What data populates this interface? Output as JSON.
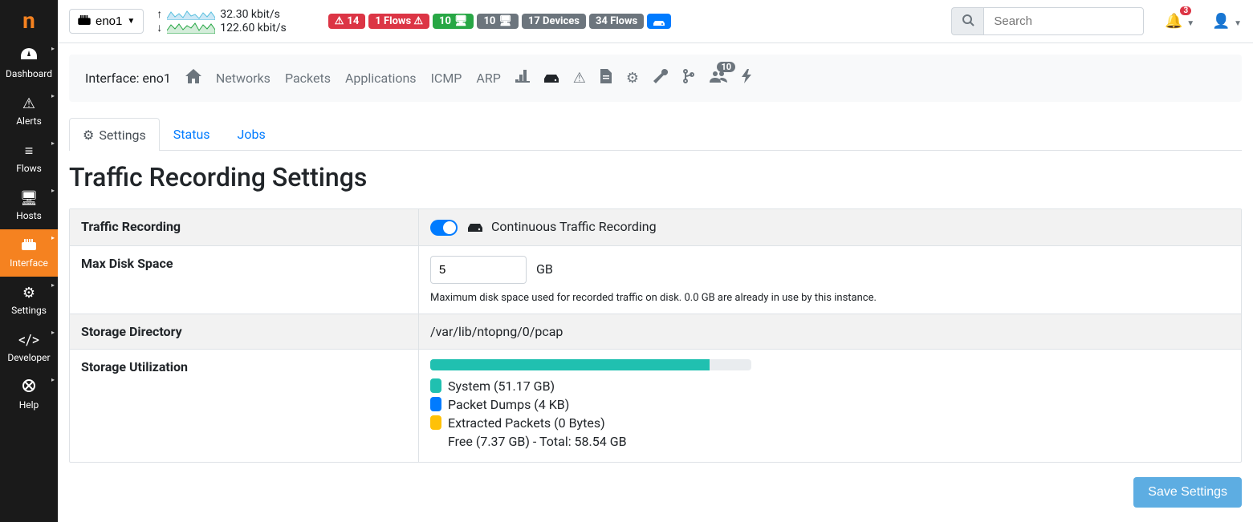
{
  "sidebar": {
    "logo": "n",
    "items": [
      {
        "icon": "dashboard",
        "label": "Dashboard"
      },
      {
        "icon": "alert",
        "label": "Alerts"
      },
      {
        "icon": "flows",
        "label": "Flows"
      },
      {
        "icon": "hosts",
        "label": "Hosts"
      },
      {
        "icon": "interface",
        "label": "Interface",
        "active": true
      },
      {
        "icon": "settings",
        "label": "Settings"
      },
      {
        "icon": "dev",
        "label": "Developer"
      },
      {
        "icon": "help",
        "label": "Help"
      }
    ]
  },
  "topbar": {
    "interface_button": "eno1",
    "up_rate": "32.30 kbit/s",
    "down_rate": "122.60 kbit/s",
    "badges": [
      {
        "style": "b-red",
        "icon": "⚠",
        "text": "14"
      },
      {
        "style": "b-red",
        "icon": "",
        "text": "1 Flows ⚠"
      },
      {
        "style": "b-green",
        "icon": "🖥",
        "text": "10"
      },
      {
        "style": "b-grey",
        "icon": "🖥",
        "text": "10"
      },
      {
        "style": "b-grey",
        "icon": "",
        "text": "17 Devices"
      },
      {
        "style": "b-grey",
        "icon": "",
        "text": "34 Flows"
      },
      {
        "style": "b-blue",
        "icon": "💾",
        "text": ""
      }
    ],
    "search_placeholder": "Search",
    "notif_count": "3"
  },
  "secnav": {
    "label": "Interface: eno1",
    "links": [
      "Networks",
      "Packets",
      "Applications",
      "ICMP",
      "ARP"
    ],
    "users_badge": "10"
  },
  "tabs": {
    "settings": "Settings",
    "status": "Status",
    "jobs": "Jobs"
  },
  "page_title": "Traffic Recording Settings",
  "form": {
    "traffic_recording_label": "Traffic Recording",
    "traffic_recording_desc": "Continuous Traffic Recording",
    "max_disk_label": "Max Disk Space",
    "max_disk_value": "5",
    "max_disk_unit": "GB",
    "max_disk_help": "Maximum disk space used for recorded traffic on disk. 0.0 GB are already in use by this instance.",
    "storage_dir_label": "Storage Directory",
    "storage_dir_value": "/var/lib/ntopng/0/pcap",
    "storage_util_label": "Storage Utilization",
    "util": {
      "system": "System (51.17 GB)",
      "dumps": "Packet Dumps (4 KB)",
      "extracted": "Extracted Packets (0 Bytes)",
      "free_total": "Free (7.37 GB)   -   Total: 58.54 GB",
      "system_pct": 87,
      "dumps_pct": 0,
      "extracted_pct": 0
    },
    "save_label": "Save Settings"
  },
  "colors": {
    "accent": "#f58220",
    "primary": "#007bff",
    "teal": "#20c0b0",
    "yellow": "#ffc107"
  }
}
